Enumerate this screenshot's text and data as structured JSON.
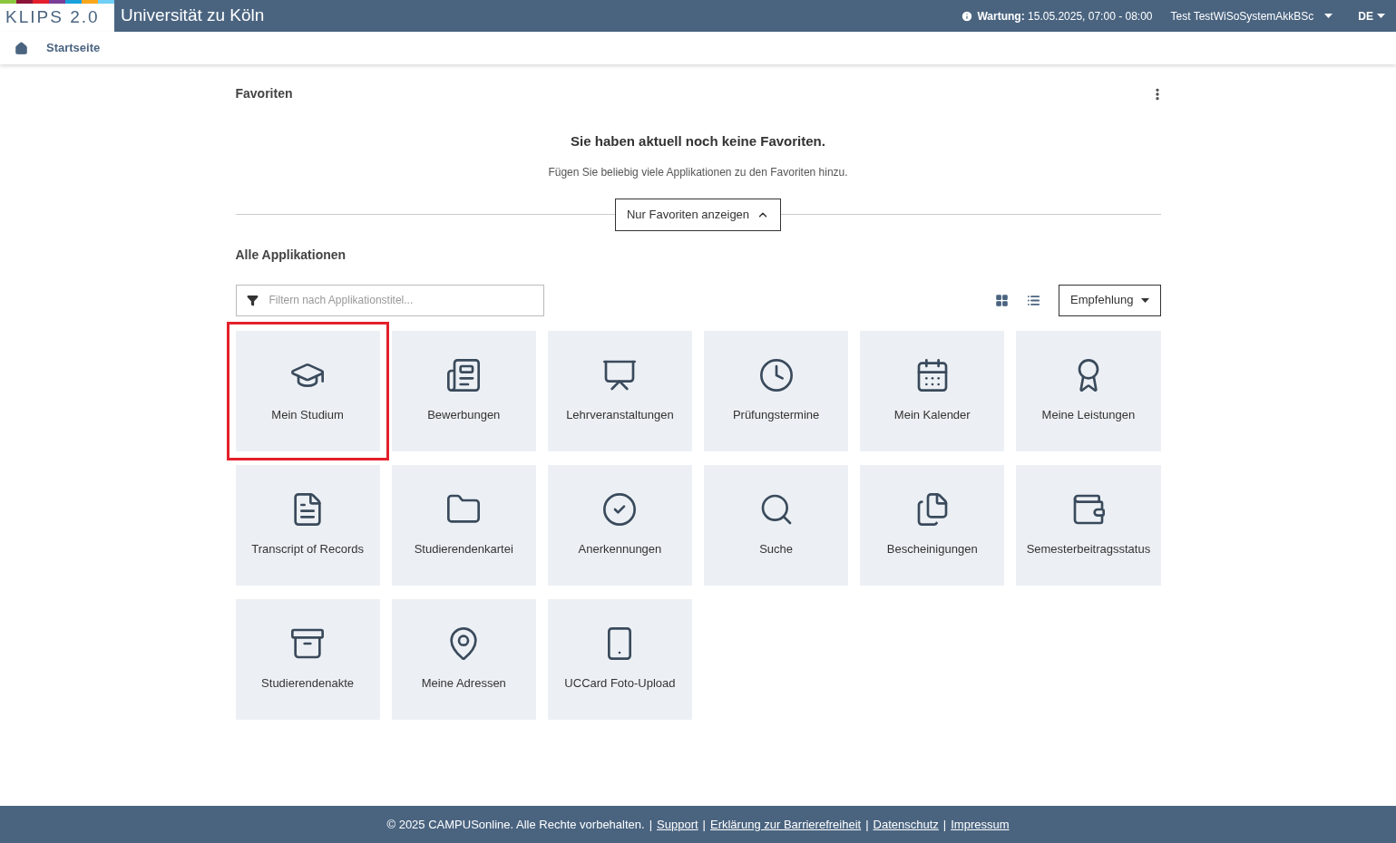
{
  "header": {
    "logo": "KLIPS 2.0",
    "title": "Universität zu Köln",
    "maintenance_label": "Wartung:",
    "maintenance_time": "15.05.2025, 07:00 - 08:00",
    "user": "Test TestWiSoSystemAkkBSc",
    "language": "DE"
  },
  "breadcrumb": {
    "label": "Startseite"
  },
  "favorites": {
    "title": "Favoriten",
    "empty_title": "Sie haben aktuell noch keine Favoriten.",
    "empty_text": "Fügen Sie beliebig viele Applikationen zu den Favoriten hinzu.",
    "toggle_button": "Nur Favoriten anzeigen"
  },
  "applications": {
    "title": "Alle Applikationen",
    "filter": {
      "placeholder": "Filtern nach Applikationstitel..."
    },
    "sort_button": "Empfehlung",
    "tiles": [
      {
        "label": "Mein Studium",
        "highlighted": true
      },
      {
        "label": "Bewerbungen",
        "highlighted": false
      },
      {
        "label": "Lehrveranstaltungen",
        "highlighted": false
      },
      {
        "label": "Prüfungstermine",
        "highlighted": false
      },
      {
        "label": "Mein Kalender",
        "highlighted": false
      },
      {
        "label": "Meine Leistungen",
        "highlighted": false
      },
      {
        "label": "Transcript of Records",
        "highlighted": false
      },
      {
        "label": "Studierendenkartei",
        "highlighted": false
      },
      {
        "label": "Anerkennungen",
        "highlighted": false
      },
      {
        "label": "Suche",
        "highlighted": false
      },
      {
        "label": "Bescheinigungen",
        "highlighted": false
      },
      {
        "label": "Semesterbeitragsstatus",
        "highlighted": false
      },
      {
        "label": "Studierendenakte",
        "highlighted": false
      },
      {
        "label": "Meine Adressen",
        "highlighted": false
      },
      {
        "label": "UCCard Foto-Upload",
        "highlighted": false
      }
    ]
  },
  "footer": {
    "copyright": "© 2025 CAMPUSonline. Alle Rechte vorbehalten.",
    "links": [
      {
        "separator": "|",
        "label": "Support"
      },
      {
        "separator": "|",
        "label": "Erklärung zur Barrierefreiheit"
      },
      {
        "separator": "|",
        "label": "Datenschutz"
      },
      {
        "separator": "|",
        "label": "Impressum"
      }
    ]
  }
}
